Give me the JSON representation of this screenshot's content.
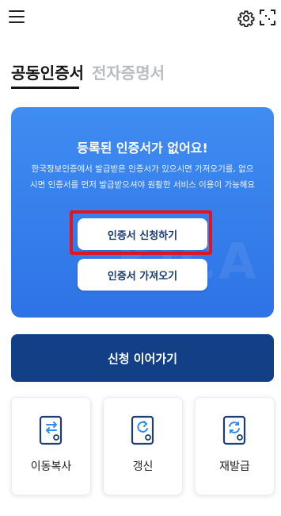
{
  "header": {
    "menu_icon": "hamburger-menu-icon",
    "settings_icon": "gear-icon",
    "scan_icon": "qr-scan-icon"
  },
  "tabs": [
    {
      "label": "공동인증서",
      "active": true
    },
    {
      "label": "전자증명서",
      "active": false
    }
  ],
  "hero": {
    "title": "등록된 인증서가 없어요!",
    "description": "한국정보인증에서 발급받은 인증서가 있으시면 가져오기를, 없으시면 인증서를 먼저 발급받으셔야 원활한 서비스 이용이 가능해요",
    "watermark": "KICA",
    "apply_button": "인증서 신청하기",
    "import_button": "인증서 가져오기",
    "colors": {
      "background": "#3f8cf2",
      "highlight": "#e3141e"
    }
  },
  "continue_button": "신청 이어가기",
  "actions": [
    {
      "label": "이동복사",
      "icon": "transfer-certificate-icon"
    },
    {
      "label": "갱신",
      "icon": "renew-certificate-icon"
    },
    {
      "label": "재발급",
      "icon": "reissue-certificate-icon"
    }
  ],
  "colors": {
    "primary_dark": "#123f86",
    "accent": "#2f8cf0"
  }
}
